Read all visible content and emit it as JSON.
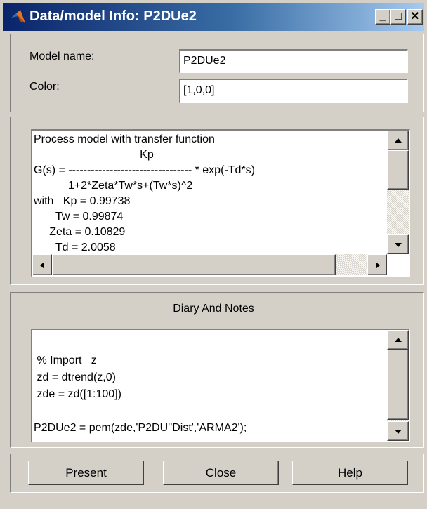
{
  "window": {
    "title": "Data/model Info: P2DUe2",
    "minimize_glyph": "_",
    "maximize_glyph": "□",
    "close_glyph": "✕"
  },
  "info": {
    "model_name_label": "Model name:",
    "model_name_value": "P2DUe2",
    "color_label": "Color:",
    "color_value": "[1,0,0]"
  },
  "model_text": {
    "lines": [
      "Process model with transfer function",
      "                                  Kp",
      "G(s) = --------------------------------- * exp(-Td*s)",
      "           1+2*Zeta*Tw*s+(Tw*s)^2",
      "with   Kp = 0.99738",
      "       Tw = 0.99874",
      "     Zeta = 0.10829",
      "       Td = 2.0058"
    ]
  },
  "diary": {
    "title": "Diary And Notes",
    "lines": [
      "",
      " % Import   z",
      " zd = dtrend(z,0)",
      " zde = zd([1:100])",
      "",
      "P2DUe2 = pem(zde,'P2DU''Dist','ARMA2');"
    ]
  },
  "buttons": {
    "present": "Present",
    "close": "Close",
    "help": "Help"
  },
  "colors": {
    "title_bar_start": "#0a246a",
    "title_bar_end": "#a6caf0",
    "face": "#d4d0c8",
    "icon_orange": "#e8731c"
  }
}
